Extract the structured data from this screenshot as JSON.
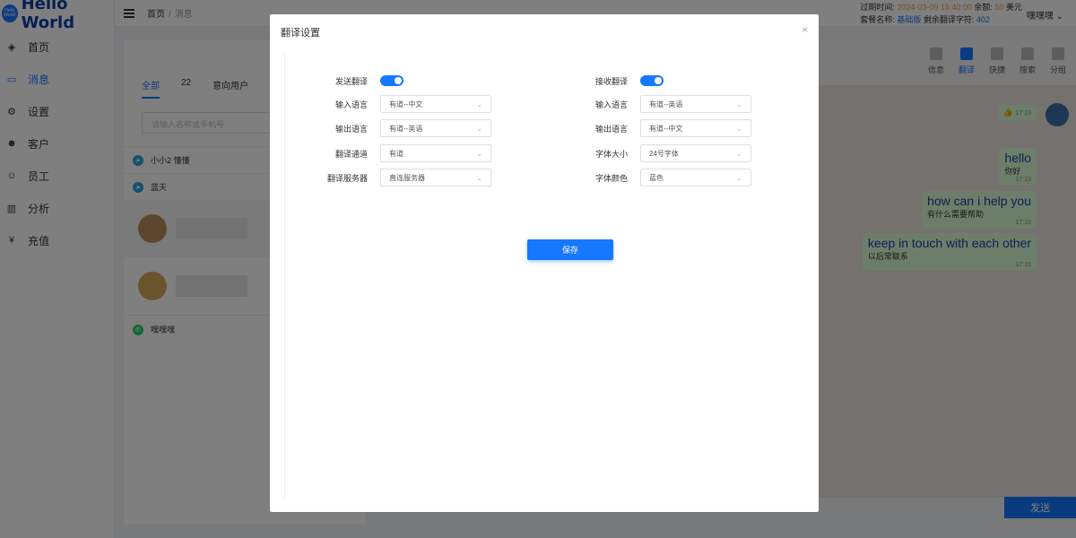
{
  "app": {
    "logo_text": "Hello World",
    "logo_badge": "Hello World"
  },
  "sidebar": {
    "items": [
      {
        "label": "首页",
        "icon": "dashboard-icon",
        "glyph": "◈"
      },
      {
        "label": "消息",
        "icon": "message-icon",
        "glyph": "▭"
      },
      {
        "label": "设置",
        "icon": "gear-icon",
        "glyph": "⚙"
      },
      {
        "label": "客户",
        "icon": "customers-icon",
        "glyph": "☻"
      },
      {
        "label": "员工",
        "icon": "employee-icon",
        "glyph": "☺"
      },
      {
        "label": "分析",
        "icon": "chart-icon",
        "glyph": "▥"
      },
      {
        "label": "充值",
        "icon": "yen-icon",
        "glyph": "¥"
      }
    ]
  },
  "topbar": {
    "breadcrumb": [
      "首页",
      "消息"
    ],
    "expire_label": "过期时间:",
    "expire_value": "2024-03-09 15:40:00",
    "balance_label": "余额:",
    "balance_value": "50",
    "balance_unit": "美元",
    "plan_label": "套餐名称:",
    "plan_value": "基础版",
    "remaining_label": "剩余翻译字符:",
    "remaining_value": "402",
    "user": "嘿嘿嘿"
  },
  "contacts": {
    "tabs": [
      "全部",
      "22",
      "意向用户"
    ],
    "search_placeholder": "请输入名称或手机号",
    "groups": [
      "小小2 懂懂",
      "蓝天"
    ],
    "whatsapp": "嘿嘿嘿"
  },
  "chat": {
    "tools": [
      "信息",
      "翻译",
      "快捷",
      "搜索",
      "分组"
    ],
    "messages": [
      {
        "en": "",
        "zh": "👍",
        "time": "17:23"
      },
      {
        "en": "hello",
        "zh": "你好",
        "time": "17:13"
      },
      {
        "en": "how can i help you",
        "zh": "有什么需要帮助",
        "time": "17:13"
      },
      {
        "en": "keep in touch with each other",
        "zh": "以后常联系",
        "time": "17:15"
      }
    ],
    "send_label": "发送"
  },
  "modal": {
    "title": "翻译设置",
    "left": [
      {
        "label": "发送翻译",
        "type": "toggle",
        "value": true
      },
      {
        "label": "输入语言",
        "type": "select",
        "value": "有道--中文"
      },
      {
        "label": "输出语言",
        "type": "select",
        "value": "有道--英语"
      },
      {
        "label": "翻译通道",
        "type": "select",
        "value": "有道"
      },
      {
        "label": "翻译服务器",
        "type": "select",
        "value": "直连服务器"
      }
    ],
    "right": [
      {
        "label": "接收翻译",
        "type": "toggle",
        "value": true
      },
      {
        "label": "输入语言",
        "type": "select",
        "value": "有道--英语"
      },
      {
        "label": "输出语言",
        "type": "select",
        "value": "有道--中文"
      },
      {
        "label": "字体大小",
        "type": "select",
        "value": "24号字体"
      },
      {
        "label": "字体颜色",
        "type": "select",
        "value": "蓝色"
      }
    ],
    "save_label": "保存"
  },
  "colors": {
    "accent": "#1677ff",
    "overlay": "rgba(0,0,0,0.5)"
  }
}
